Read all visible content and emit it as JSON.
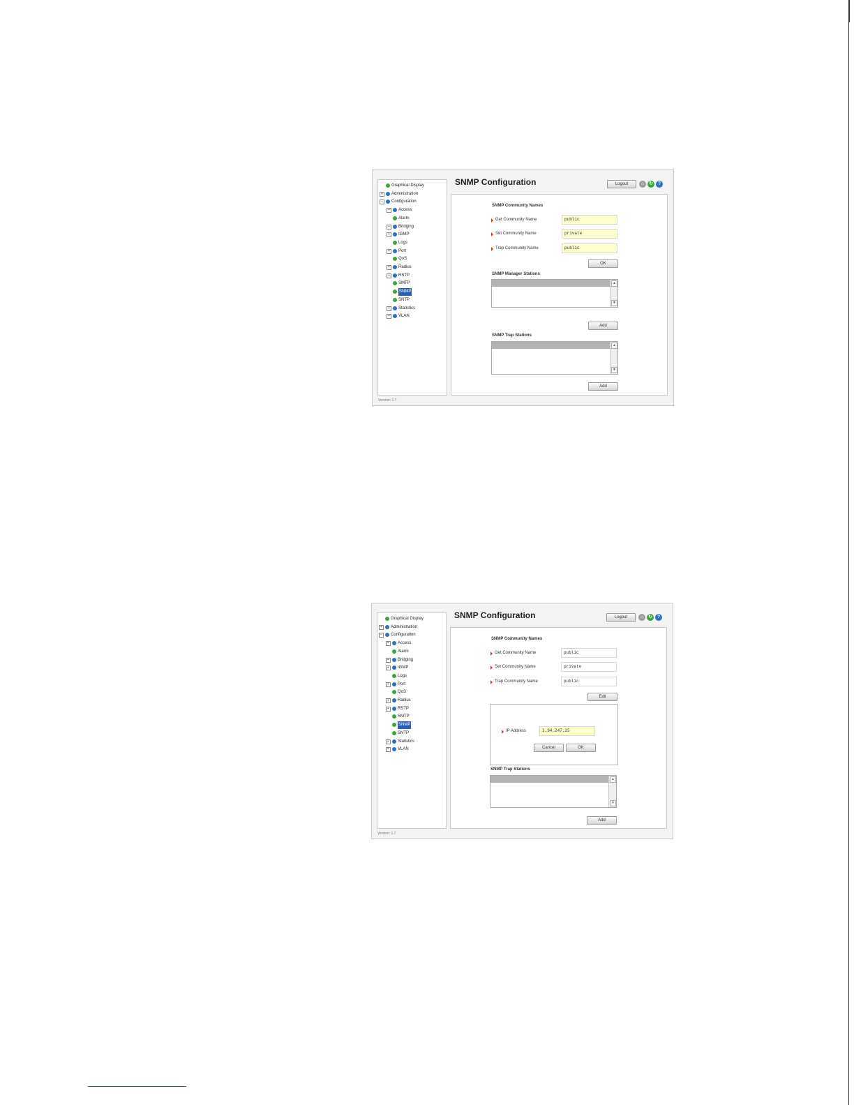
{
  "screenshots": [
    {
      "title": "SNMP Configuration",
      "logout_label": "Logout",
      "version": "Version: 1.7",
      "nav": [
        {
          "label": "Graphical Display",
          "expander": "",
          "dot": "green",
          "level": 0
        },
        {
          "label": "Administration",
          "expander": "+",
          "dot": "blue",
          "level": 0
        },
        {
          "label": "Configuration",
          "expander": "-",
          "dot": "blue",
          "level": 0
        },
        {
          "label": "Access",
          "expander": "+",
          "dot": "blue",
          "level": 1
        },
        {
          "label": "Alarm",
          "expander": "",
          "dot": "green",
          "level": 1
        },
        {
          "label": "Bridging",
          "expander": "+",
          "dot": "blue",
          "level": 1
        },
        {
          "label": "IGMP",
          "expander": "+",
          "dot": "blue",
          "level": 1
        },
        {
          "label": "Logs",
          "expander": "",
          "dot": "green",
          "level": 1
        },
        {
          "label": "Port",
          "expander": "+",
          "dot": "blue",
          "level": 1
        },
        {
          "label": "QoS",
          "expander": "",
          "dot": "green",
          "level": 1
        },
        {
          "label": "Radius",
          "expander": "+",
          "dot": "blue",
          "level": 1
        },
        {
          "label": "RSTP",
          "expander": "+",
          "dot": "blue",
          "level": 1
        },
        {
          "label": "SMTP",
          "expander": "",
          "dot": "green",
          "level": 1
        },
        {
          "label": "SNMP",
          "expander": "",
          "dot": "green",
          "level": 1,
          "selected": true
        },
        {
          "label": "SNTP",
          "expander": "",
          "dot": "green",
          "level": 1
        },
        {
          "label": "Statistics",
          "expander": "+",
          "dot": "blue",
          "level": 1
        },
        {
          "label": "VLAN",
          "expander": "+",
          "dot": "blue",
          "level": 1
        }
      ],
      "community": {
        "heading": "SNMP Community Names",
        "fields": [
          {
            "label": "Get Community Name",
            "value": "public"
          },
          {
            "label": "Set Community Name",
            "value": "private"
          },
          {
            "label": "Trap Community Name",
            "value": "public"
          }
        ],
        "button": "OK"
      },
      "manager": {
        "heading": "SNMP Manager Stations",
        "add": "Add"
      },
      "trap": {
        "heading": "SNMP Trap Stations",
        "add": "Add"
      }
    },
    {
      "title": "SNMP Configuration",
      "logout_label": "Logout",
      "version": "Version: 1.7",
      "community": {
        "heading": "SNMP Community Names",
        "fields": [
          {
            "label": "Get Community Name",
            "value": "public"
          },
          {
            "label": "Set Community Name",
            "value": "private"
          },
          {
            "label": "Trap Community Name",
            "value": "public"
          }
        ],
        "button": "Edit"
      },
      "dialog": {
        "ip_label": "IP Address",
        "ip_value": "3.94.247.25",
        "cancel": "Cancel",
        "ok": "OK"
      },
      "trap": {
        "heading": "SNMP Trap Stations",
        "add": "Add"
      }
    }
  ],
  "colors": {
    "field_highlight": "#ffffcc",
    "nav_selected": "#2b5eb5",
    "required_arrow": "#d04010"
  }
}
